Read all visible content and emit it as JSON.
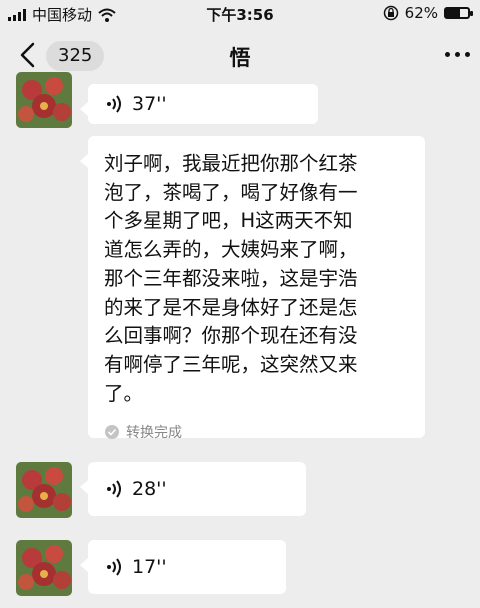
{
  "status_bar": {
    "carrier": "中国移动",
    "time": "下午3:56",
    "battery": "62%",
    "battery_level": 0.62
  },
  "header": {
    "unread_count": "325",
    "title": "悟"
  },
  "messages": [
    {
      "type": "voice",
      "duration": "37''"
    },
    {
      "type": "transcript",
      "lines": [
        "刘子啊，我最近把你那个红茶",
        "泡了，茶喝了，喝了好像有一",
        "个多星期了吧，H这两天不知",
        "道怎么弄的，大姨妈来了啊，",
        "那个三年都没来啦，这是宇浩",
        "的来了是不是身体好了还是怎",
        "么回事啊？你那个现在还有没",
        "有啊停了三年呢，这突然又来",
        "了。"
      ],
      "status": "转换完成"
    },
    {
      "type": "voice",
      "duration": "28''"
    },
    {
      "type": "voice",
      "duration": "17''"
    }
  ],
  "colors": {
    "background": "#ededed",
    "bubble": "#ffffff",
    "muted": "#888888"
  }
}
